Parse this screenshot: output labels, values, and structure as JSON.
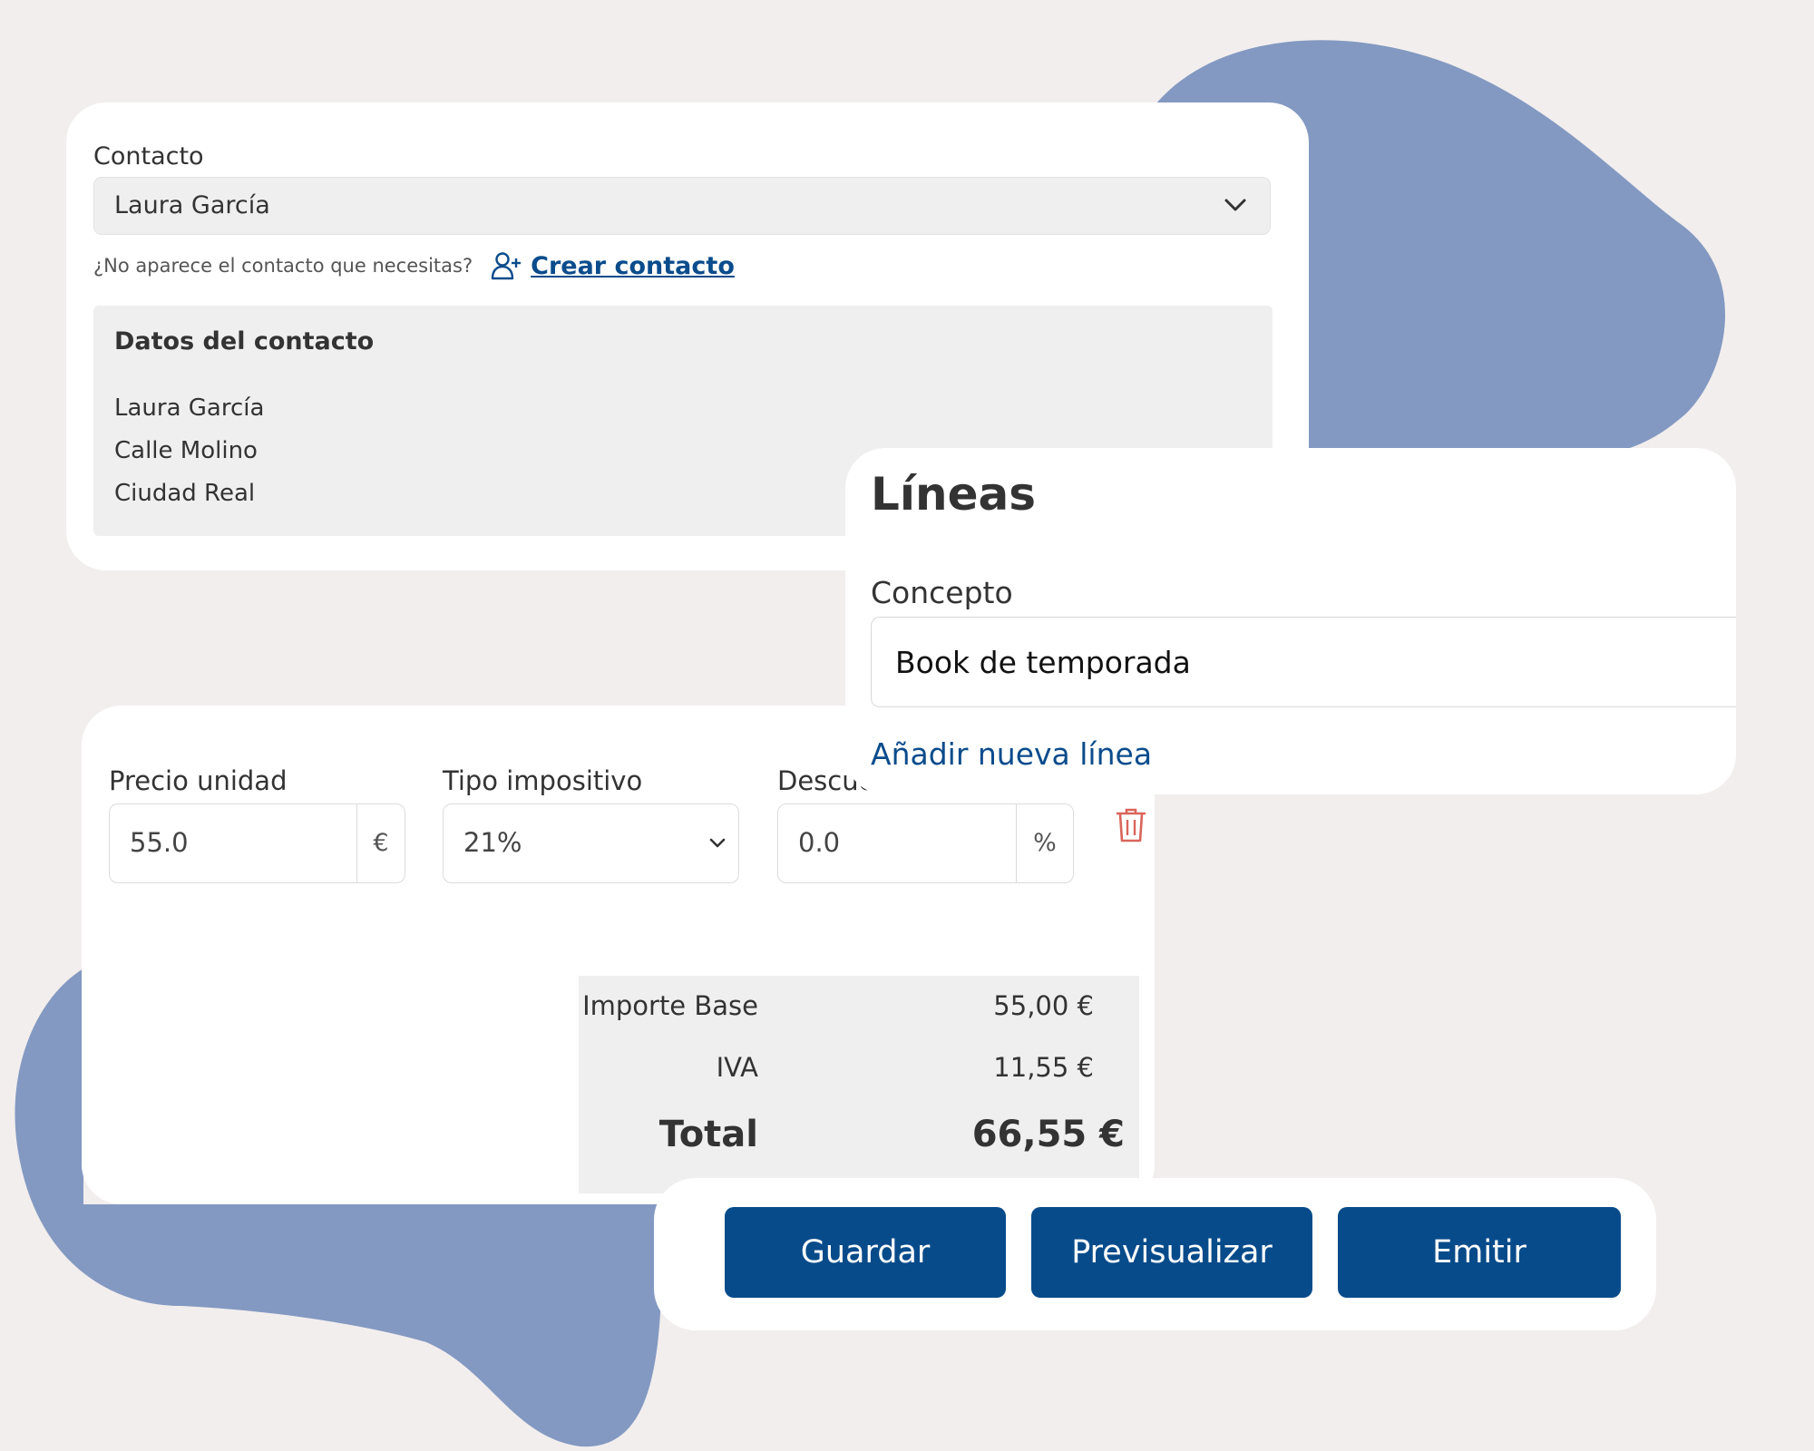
{
  "contact": {
    "label": "Contacto",
    "selected": "Laura García",
    "hint": "¿No aparece el contacto que necesitas?",
    "create_link": "Crear contacto",
    "details": {
      "title": "Datos del contacto",
      "name": "Laura García",
      "street": "Calle Molino",
      "city": "Ciudad Real"
    }
  },
  "lines": {
    "title": "Líneas",
    "concept_label": "Concepto",
    "concept_value": "Book de temporada",
    "add_line": "Añadir nueva línea"
  },
  "line_item": {
    "unit_price_label": "Precio unidad",
    "unit_price_value": "55.0",
    "currency_suffix": "€",
    "tax_label": "Tipo impositivo",
    "tax_value": "21%",
    "discount_label": "Descue",
    "discount_value": "0.0",
    "discount_suffix": "%"
  },
  "totals": {
    "base_label": "Importe Base",
    "base_value": "55,00 €",
    "iva_label": "IVA",
    "iva_value": "11,55 €",
    "total_label": "Total",
    "total_value": "66,55 €"
  },
  "actions": {
    "save": "Guardar",
    "preview": "Previsualizar",
    "issue": "Emitir"
  },
  "colors": {
    "accent": "#084b8a",
    "background": "#f2eeee",
    "blob": "#8399c1",
    "danger": "#d9655a"
  }
}
